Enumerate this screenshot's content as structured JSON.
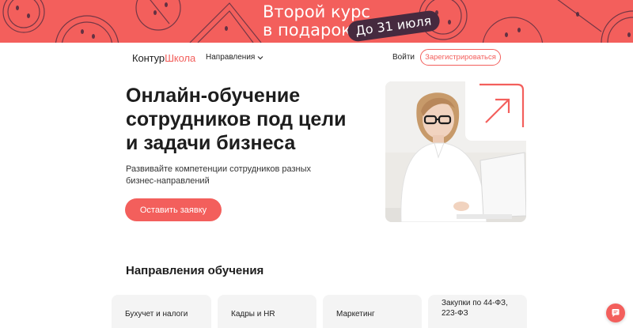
{
  "promo": {
    "title_line1": "Второй курс",
    "title_line2": "в подарок",
    "badge": "До 31 июля",
    "background_color": "#f35f5c",
    "badge_color": "#462a3f"
  },
  "header": {
    "logo_part1": "Контур",
    "logo_part2": "Школа",
    "directions_label": "Направления",
    "login_label": "Войти",
    "register_label": "Зарегистрироваться",
    "chevron_icon": "chevron-down-icon"
  },
  "hero": {
    "title_line1": "Онлайн-обучение",
    "title_line2": "сотрудников под цели",
    "title_line3": "и задачи бизнеса",
    "subtitle": "Развивайте компетенции сотрудников разных бизнес-направлений",
    "cta_label": "Оставить заявку",
    "accent_color": "#f35f5c",
    "arrow_icon": "arrow-up-right-icon"
  },
  "directions": {
    "title": "Направления обучения",
    "cards": [
      {
        "line1": "Бухучет и налоги",
        "line2": ""
      },
      {
        "line1": "Кадры и HR",
        "line2": ""
      },
      {
        "line1": "Маркетинг",
        "line2": ""
      },
      {
        "line1": "Закупки по 44-ФЗ,",
        "line2": "223-ФЗ"
      }
    ]
  },
  "chat": {
    "icon": "chat-icon"
  }
}
